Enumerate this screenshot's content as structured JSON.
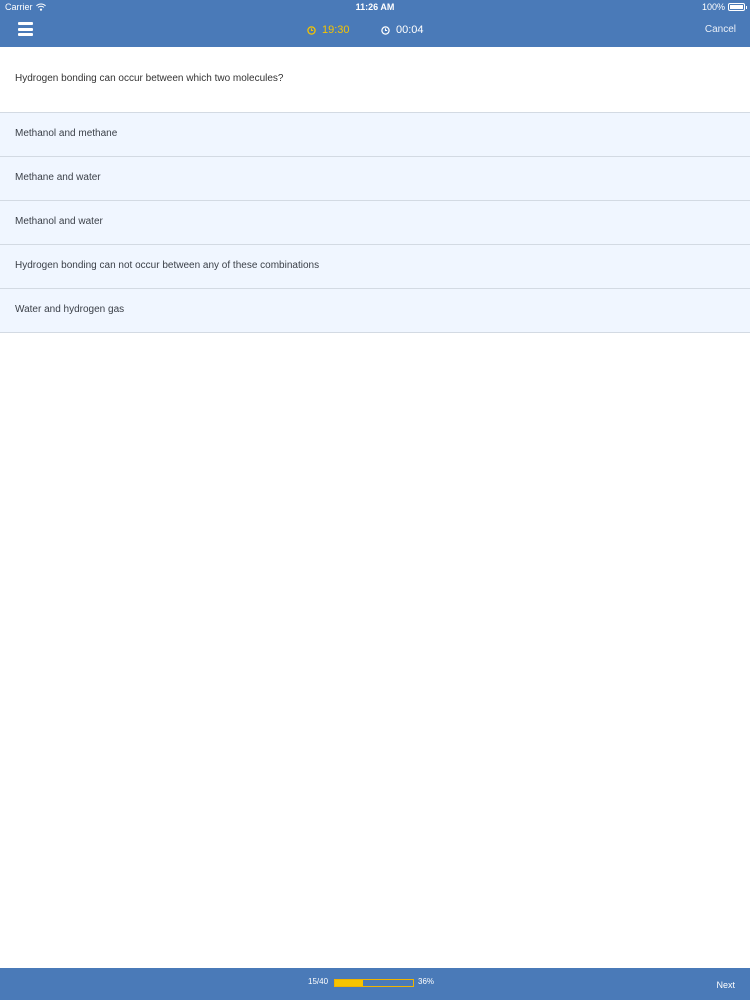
{
  "status_bar": {
    "carrier": "Carrier",
    "time": "11:26 AM",
    "battery": "100%"
  },
  "header": {
    "menu_icon": "hamburger-menu-icon",
    "timer_remaining": "19:30",
    "timer_elapsed": "00:04",
    "cancel_label": "Cancel",
    "accent_color": "#f5c400",
    "bar_color": "#4a7ab8"
  },
  "question": {
    "text": "Hydrogen bonding can occur between which two molecules?"
  },
  "answers": [
    "Methanol and methane",
    "Methane and water",
    "Methanol and water",
    "Hydrogen bonding can not occur between any of these combinations",
    "Water and hydrogen gas"
  ],
  "footer": {
    "progress_count": "15/40",
    "progress_percent_label": "36%",
    "progress_fraction": 0.36,
    "next_label": "Next"
  }
}
